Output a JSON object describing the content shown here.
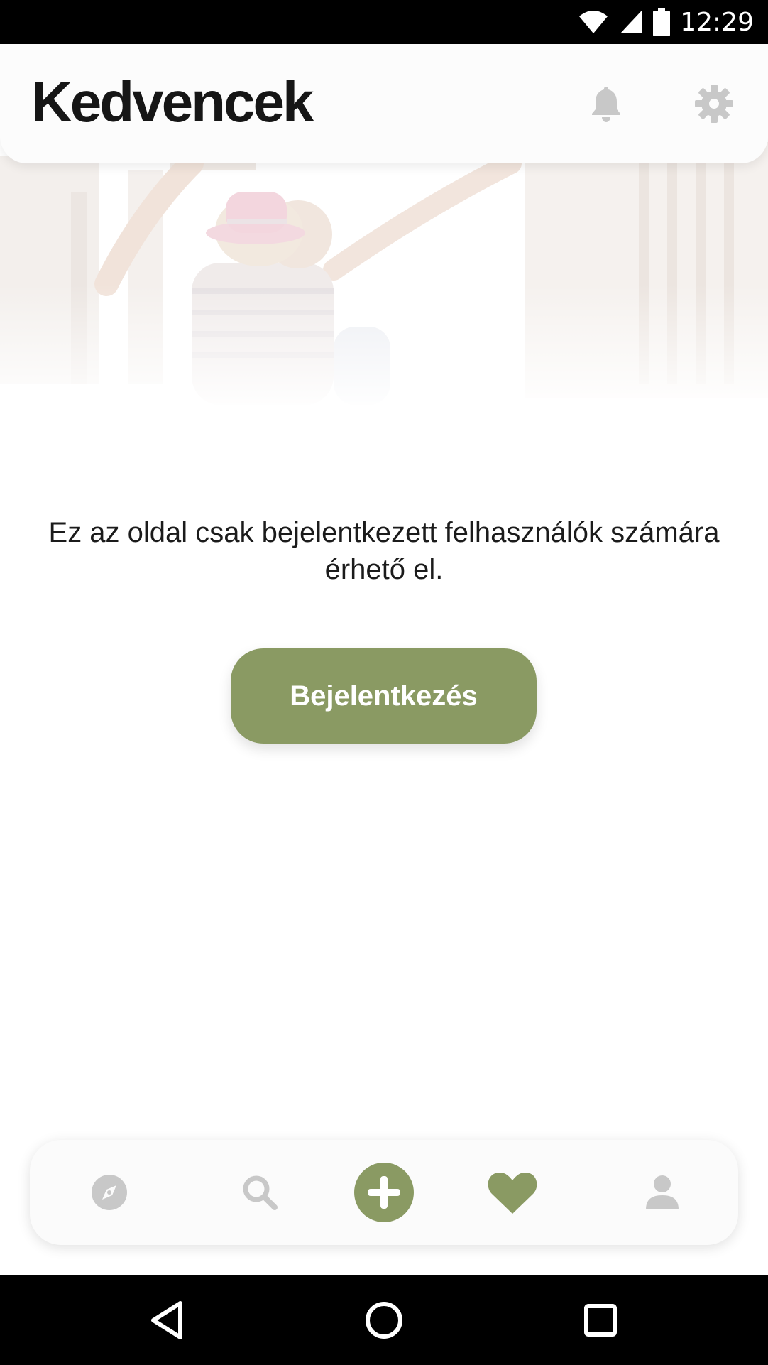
{
  "status_bar": {
    "time": "12:29",
    "icons": [
      "wifi-icon",
      "signal-icon",
      "battery-icon"
    ]
  },
  "header": {
    "title": "Kedvencek",
    "icons": [
      "bell-icon",
      "gear-icon"
    ]
  },
  "main": {
    "message": "Ez az oldal csak bejelentkezett felhasználók számára érhető el.",
    "login_button": "Bejelentkezés"
  },
  "bottom_nav": {
    "items": [
      "compass-icon",
      "search-icon",
      "add-icon",
      "heart-icon",
      "profile-icon"
    ],
    "active": "heart-icon"
  },
  "system_nav": [
    "back-icon",
    "home-icon",
    "recents-icon"
  ],
  "colors": {
    "accent": "#8a9a63",
    "inactive_icon": "#c8c8c8",
    "title": "#161616"
  }
}
